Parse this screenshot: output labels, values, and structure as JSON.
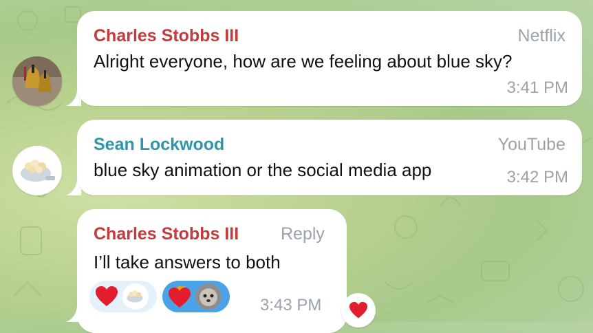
{
  "colors": {
    "charles_name": "#c43b3b",
    "sean_name": "#2f95a8",
    "meta": "#9aa3ab",
    "reaction_pill_light": "#e4f1fb",
    "reaction_pill_active": "#4aa3e6",
    "heart": "#e11d2e"
  },
  "messages": [
    {
      "sender": "Charles Stobbs III",
      "label": "Netflix",
      "text": "Alright everyone, how are we feeling about blue sky?",
      "time": "3:41 PM",
      "avatar": "bells-avatar"
    },
    {
      "sender": "Sean Lockwood",
      "label": "YouTube",
      "text": "blue sky animation or the social media app",
      "time": "3:42 PM",
      "avatar": "popcorn-avatar"
    },
    {
      "sender": "Charles Stobbs III",
      "reply_label": "Reply",
      "text": "I’ll take answers to both",
      "time": "3:43 PM",
      "reactions": [
        {
          "icon": "heart-icon",
          "avatar": "popcorn-avatar",
          "active": false
        },
        {
          "icon": "heart-on-fire-icon",
          "avatar": "dog-avatar",
          "active": true
        }
      ],
      "badge_icon": "heart-icon"
    }
  ]
}
